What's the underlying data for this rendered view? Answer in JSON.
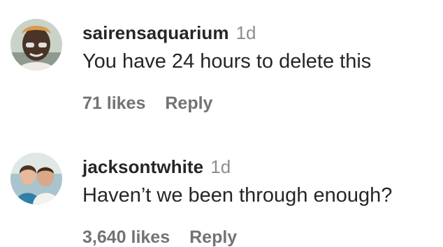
{
  "comments": [
    {
      "username": "sairensaquarium",
      "time": "1d",
      "text": "You have 24 hours to delete this",
      "likes": "71 likes",
      "reply_label": "Reply",
      "avatar_icon": "profile-photo"
    },
    {
      "username": "jacksontwhite",
      "time": "1d",
      "text": "Haven’t we been through enough?",
      "likes": "3,640 likes",
      "reply_label": "Reply",
      "avatar_icon": "profile-photo"
    }
  ]
}
